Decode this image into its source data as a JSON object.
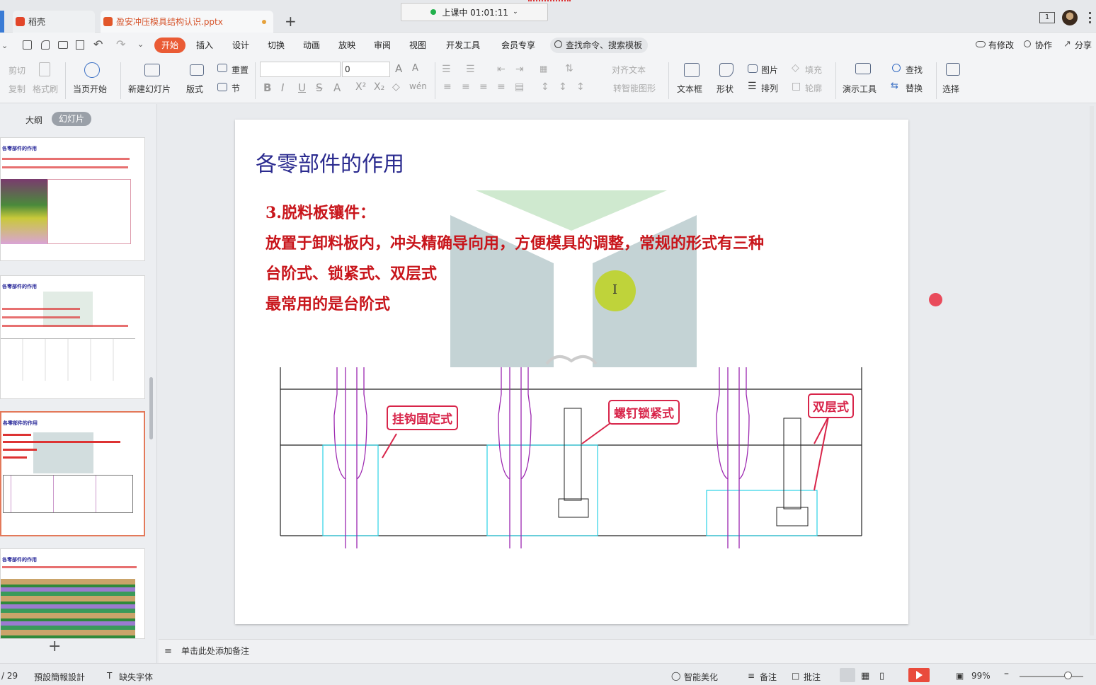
{
  "titlebar": {
    "tabs": [
      {
        "label": "稻壳"
      },
      {
        "label": "盈安冲压模具结构认识.pptx"
      }
    ],
    "new_tab": "+",
    "recording": "上课中 01:01:11",
    "page_box": "1"
  },
  "menubar": {
    "items": [
      "开始",
      "插入",
      "设计",
      "切换",
      "动画",
      "放映",
      "审阅",
      "视图",
      "开发工具",
      "会员专享"
    ],
    "search": "查找命令、搜索模板",
    "right": [
      "有修改",
      "协作",
      "分享"
    ]
  },
  "ribbon": {
    "clipboard": [
      "剪切",
      "复制",
      "格式刷"
    ],
    "play_from_current": "当页开始",
    "new_slide": "新建幻灯片",
    "layout": "版式",
    "reset": "重置",
    "section": "节",
    "font_size": "0",
    "align_text": "对齐文本",
    "smart_art": "转智能图形",
    "textbox": "文本框",
    "shape": "形状",
    "picture": "图片",
    "arrange": "排列",
    "fill": "填充",
    "outline": "轮廓",
    "present_tools": "演示工具",
    "find": "查找",
    "replace": "替换",
    "select": "选择"
  },
  "leftpanel": {
    "tab_outline": "大纲",
    "tab_slides": "幻灯片",
    "thumb_titles": [
      "各零部件的作用",
      "各零部件的作用",
      "各零部件的作用",
      "各零部件的作用"
    ],
    "add_slide": "+"
  },
  "slide": {
    "title": "各零部件的作用",
    "heading": "3.脱料板镶件：",
    "line1": "放置于卸料板内，冲头精确导向用，方便模具的调整，常规的形式有三种",
    "line2": "台阶式、锁紧式、双层式",
    "line3": "最常用的是台阶式",
    "callouts": [
      "挂钩固定式",
      "螺钉锁紧式",
      "双层式"
    ],
    "cursor_glyph": "I"
  },
  "notes": {
    "placeholder": "单击此处添加备注"
  },
  "statusbar": {
    "page": "/ 29",
    "design": "預設簡報設計",
    "missing_font": "缺失字体",
    "beautify": "智能美化",
    "notes": "备注",
    "comment": "批注",
    "zoom": "99%"
  },
  "colors": {
    "accent": "#ea5b35",
    "slide_red": "#c8151b",
    "slide_title": "#2b2b8f",
    "callout_border": "#d8254a",
    "cad_cyan": "#2bd3e6",
    "cad_magenta": "#9c27b0"
  }
}
